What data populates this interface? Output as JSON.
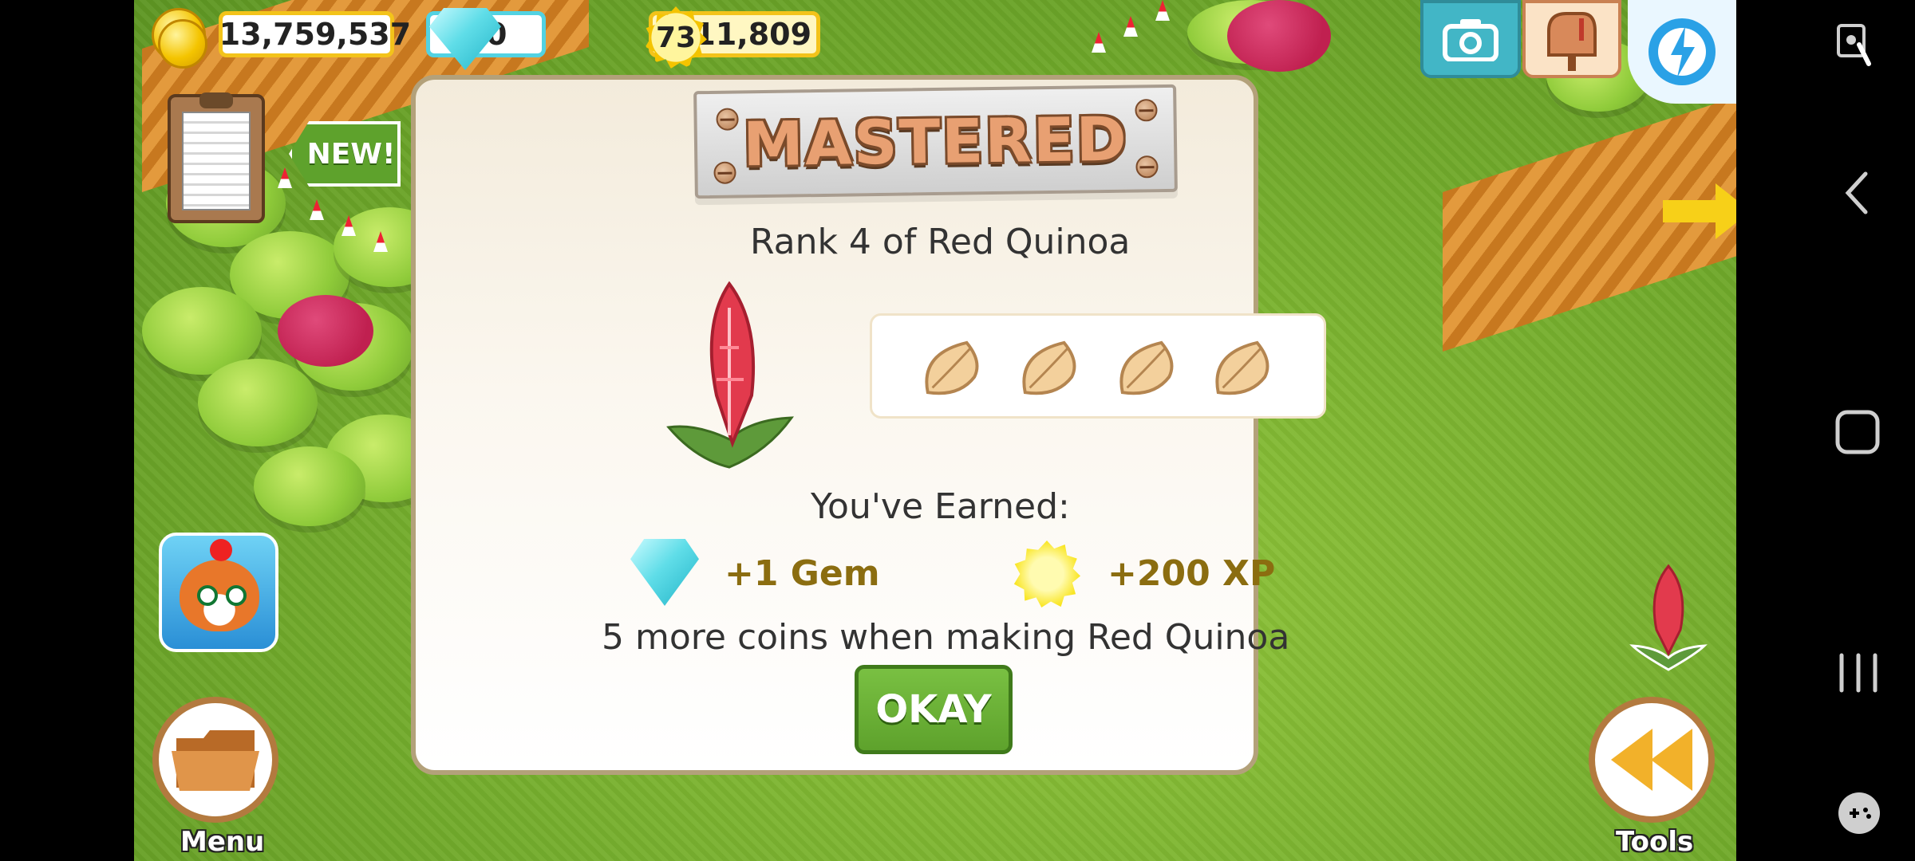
{
  "hud": {
    "coins": "13,759,537",
    "gems": "20",
    "level": "73",
    "xp": "411,809"
  },
  "badges": {
    "new": "NEW!"
  },
  "dialog": {
    "banner_title": "MASTERED",
    "subtitle": "Rank 4 of Red Quinoa",
    "rank_seeds": 4,
    "earned_label": "You've Earned:",
    "reward_gem": "+1 Gem",
    "reward_xp": "+200 XP",
    "bonus_text": "5 more coins when making Red Quinoa",
    "okay_label": "OKAY"
  },
  "bottom": {
    "menu_label": "Menu",
    "tools_label": "Tools"
  },
  "icons": {
    "camera": "camera-icon",
    "mailbox": "mailbox-icon",
    "speed": "speed-icon",
    "clipboard": "clipboard-icon"
  },
  "colors": {
    "gold_accent": "#f3c31a",
    "okay_green": "#5ea22c",
    "reward_text": "#8b6d10"
  }
}
